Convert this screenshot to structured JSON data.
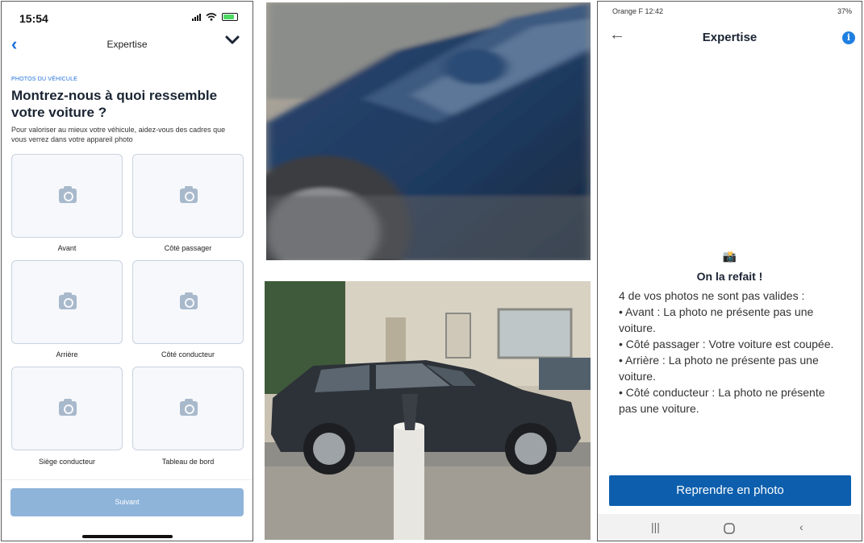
{
  "left_phone": {
    "status": {
      "time": "15:54"
    },
    "nav": {
      "title": "Expertise"
    },
    "section_label": "PHOTOS DU VÉHICULE",
    "title": "Montrez-nous à quoi ressemble votre voiture ?",
    "description": "Pour valoriser au mieux votre véhicule, aidez-vous des cadres que vous verrez dans votre appareil photo",
    "slots": [
      {
        "label": "Avant"
      },
      {
        "label": "Côté passager"
      },
      {
        "label": "Arrière"
      },
      {
        "label": "Côté conducteur"
      },
      {
        "label": "Siège conducteur"
      },
      {
        "label": "Tableau de bord"
      }
    ],
    "next_button": "Suivant",
    "colors": {
      "accent": "#1e6fd9",
      "button_disabled": "#8fb4da"
    }
  },
  "right_phone": {
    "status": {
      "left": "Orange F 12:42",
      "right": "37%"
    },
    "nav": {
      "title": "Expertise"
    },
    "emoji": "📸",
    "retake_title": "On la refait !",
    "retake_intro": "4 de vos photos ne sont pas valides :",
    "issues": [
      "• Avant : La photo ne présente pas une voiture.",
      "• Côté passager : Votre voiture est coupée.",
      "• Arrière : La photo ne présente pas une voiture.",
      "• Côté conducteur : La photo ne présente pas une voiture."
    ],
    "retake_button": "Reprendre en photo",
    "colors": {
      "button": "#0d5fad",
      "info": "#1e7fe0"
    }
  }
}
